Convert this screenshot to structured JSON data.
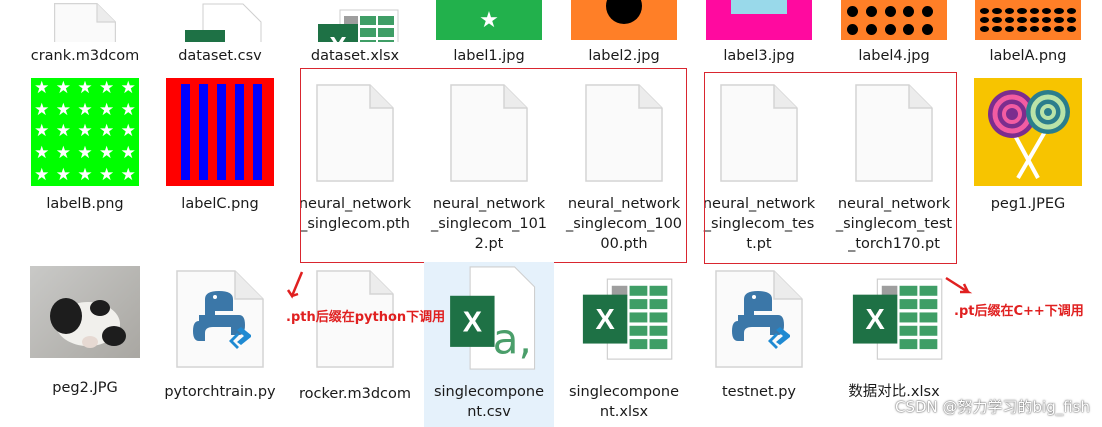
{
  "files": {
    "crank": {
      "name": "crank.m3dcom",
      "icon": "blank-document-icon"
    },
    "dataset_csv": {
      "name": "dataset.csv",
      "icon": "excel-csv-icon"
    },
    "dataset_xlsx": {
      "name": "dataset.xlsx",
      "icon": "excel-xlsx-icon"
    },
    "label1": {
      "name": "label1.jpg",
      "icon": "image-thumbnail"
    },
    "label2": {
      "name": "label2.jpg",
      "icon": "image-thumbnail"
    },
    "label3": {
      "name": "label3.jpg",
      "icon": "image-thumbnail"
    },
    "label4": {
      "name": "label4.jpg",
      "icon": "image-thumbnail"
    },
    "labelA": {
      "name": "labelA.png",
      "icon": "image-thumbnail"
    },
    "labelB": {
      "name": "labelB.png",
      "icon": "image-thumbnail"
    },
    "labelC": {
      "name": "labelC.png",
      "icon": "image-thumbnail"
    },
    "nn_pth": {
      "name": "neural_network_singlecom.pth",
      "icon": "blank-document-icon"
    },
    "nn_1012": {
      "name": "neural_network_singlecom_1012.pt",
      "icon": "blank-document-icon"
    },
    "nn_10000": {
      "name": "neural_network_singlecom_10000.pth",
      "icon": "blank-document-icon"
    },
    "nn_test": {
      "name": "neural_network_singlecom_test.pt",
      "icon": "blank-document-icon"
    },
    "nn_torch170": {
      "name": "neural_network_singlecom_test_torch170.pt",
      "icon": "blank-document-icon"
    },
    "peg1": {
      "name": "peg1.JPEG",
      "icon": "image-thumbnail"
    },
    "peg2": {
      "name": "peg2.JPG",
      "icon": "image-thumbnail"
    },
    "pytorchtrain": {
      "name": "pytorchtrain.py",
      "icon": "python-file-icon"
    },
    "rocker": {
      "name": "rocker.m3dcom",
      "icon": "blank-document-icon"
    },
    "sc_csv": {
      "name": "singlecomponent.csv",
      "icon": "excel-csv-icon"
    },
    "sc_xlsx": {
      "name": "singlecomponent.xlsx",
      "icon": "excel-xlsx-icon"
    },
    "testnet": {
      "name": "testnet.py",
      "icon": "python-file-icon"
    },
    "compare": {
      "name": "数据对比.xlsx",
      "icon": "excel-xlsx-icon"
    }
  },
  "annotations": {
    "pth_note": ".pth后缀在python下调用",
    "pt_note": ".pt后缀在C++下调用",
    "color": "#e02020"
  },
  "watermark": "CSDN @努力学习的big_fish"
}
